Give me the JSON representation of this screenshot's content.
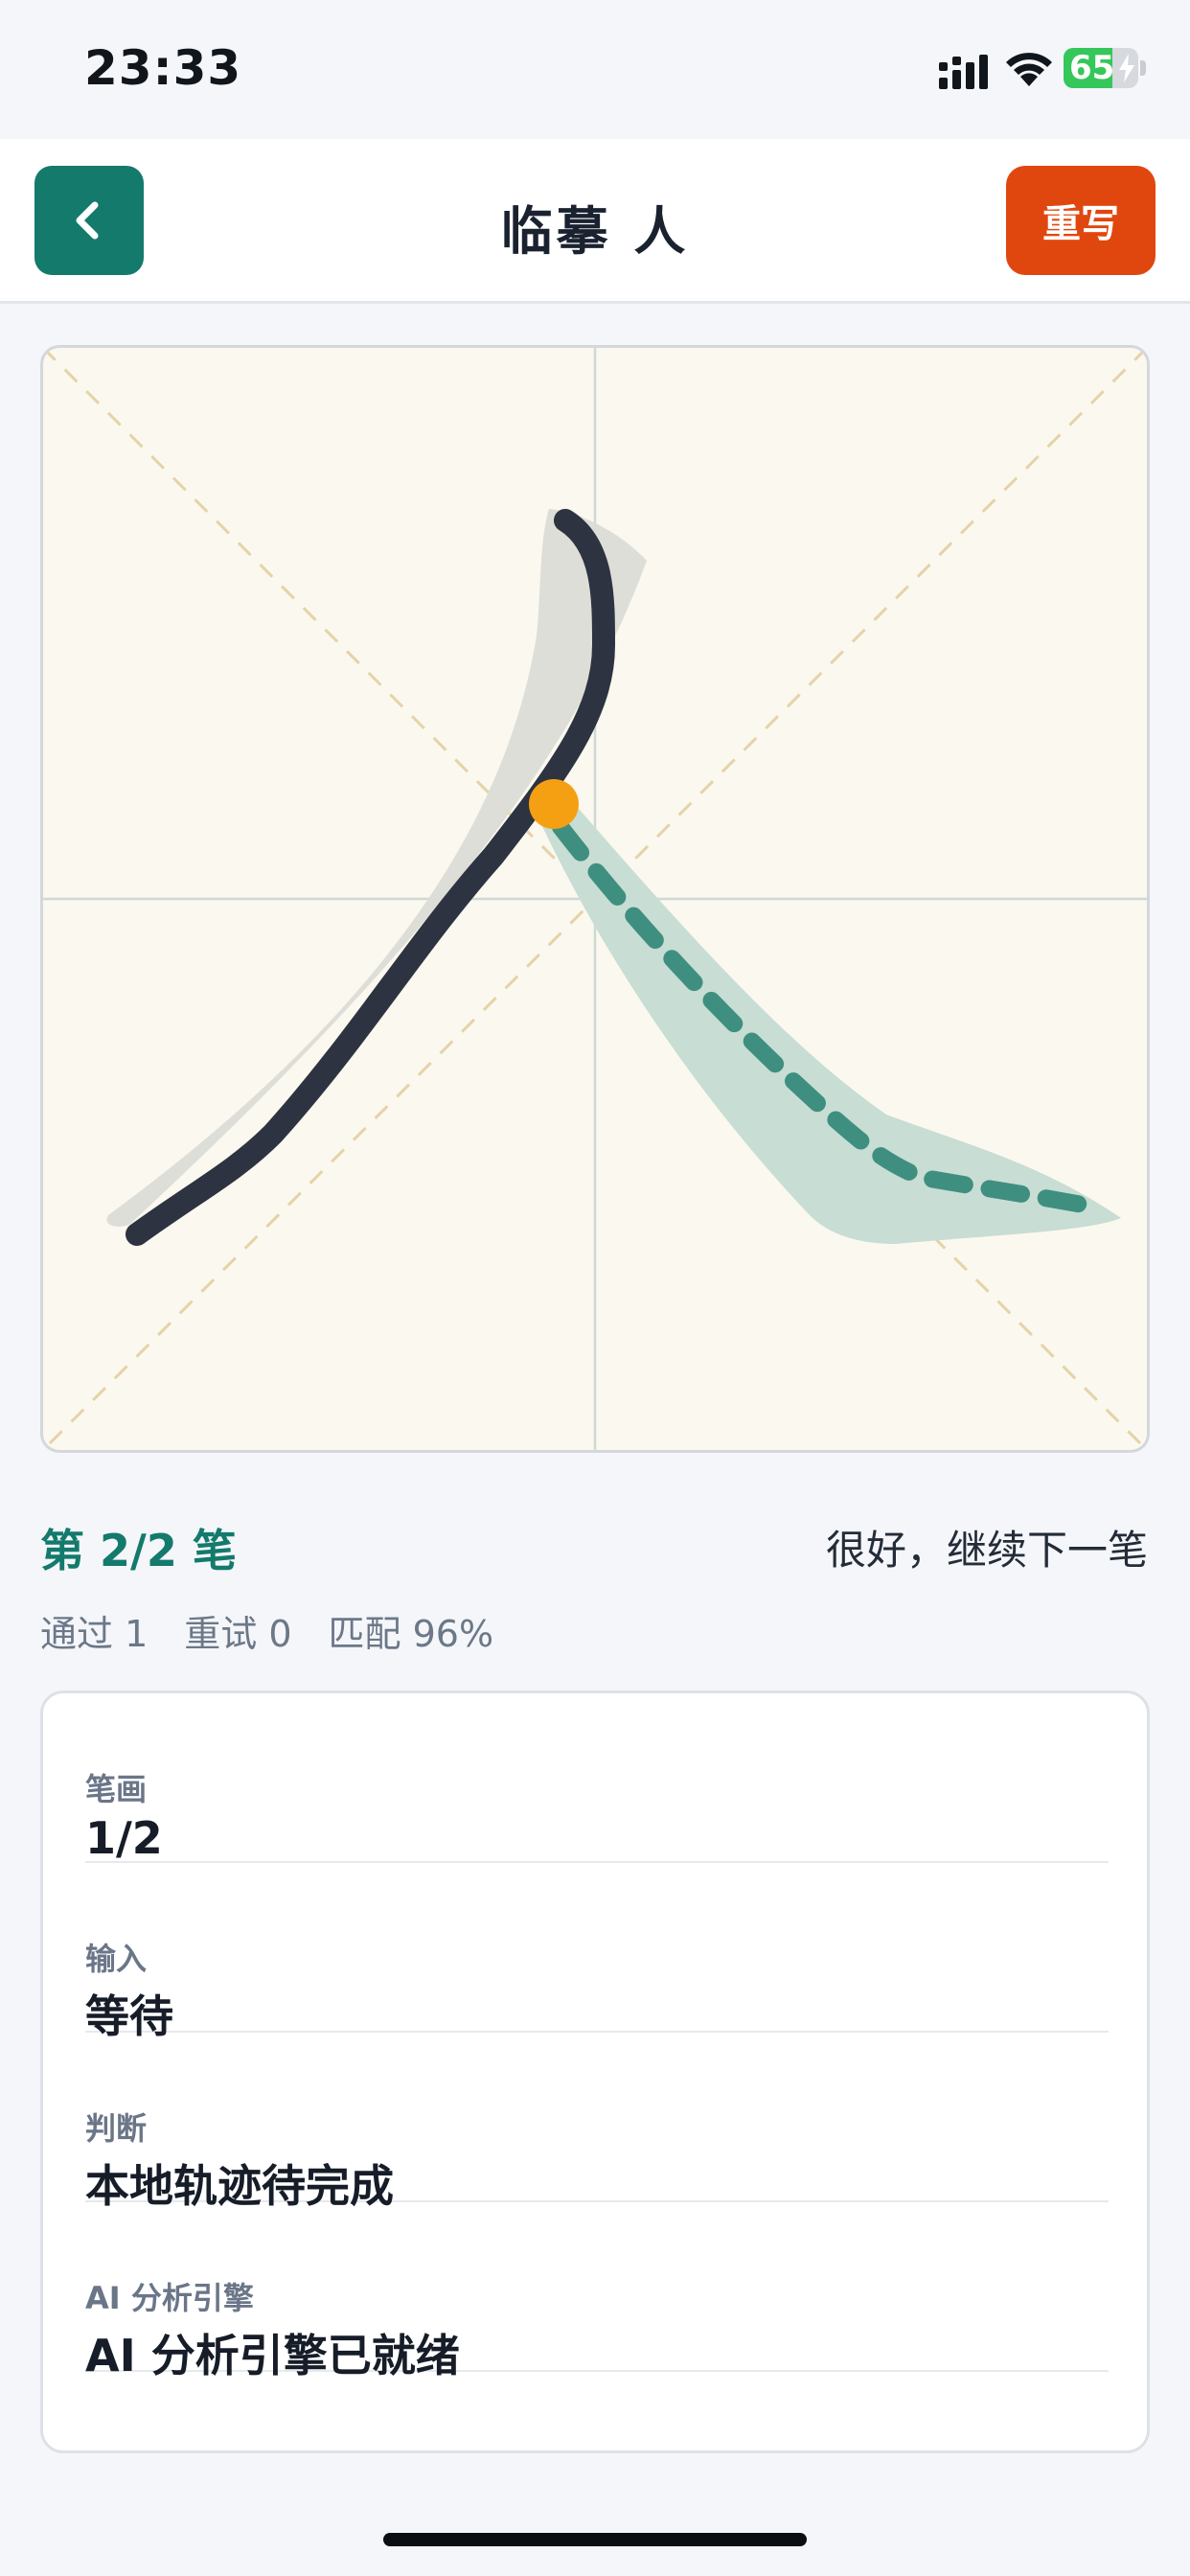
{
  "status_bar": {
    "time": "23:33",
    "battery": "65",
    "battery_level": 0.65
  },
  "header": {
    "back_icon": "chevron-left-icon",
    "title": "临摹 人",
    "rewrite_label": "重写"
  },
  "colors": {
    "accent": "#137a6c",
    "rewrite": "#e0470f",
    "ink": "#2d3340",
    "guide": "#c8ddd3",
    "dot": "#f5a012"
  },
  "practice": {
    "stroke_progress": "第 2/2 笔",
    "feedback": "很好，继续下一笔",
    "stats": {
      "passed": "通过 1",
      "retry": "重试 0",
      "match": "匹配 96%"
    }
  },
  "info": [
    {
      "label": "笔画",
      "value": "1/2"
    },
    {
      "label": "输入",
      "value": "等待"
    },
    {
      "label": "判断",
      "value": "本地轨迹待完成"
    },
    {
      "label": "AI 分析引擎",
      "value": "AI 分析引擎已就绪"
    }
  ]
}
